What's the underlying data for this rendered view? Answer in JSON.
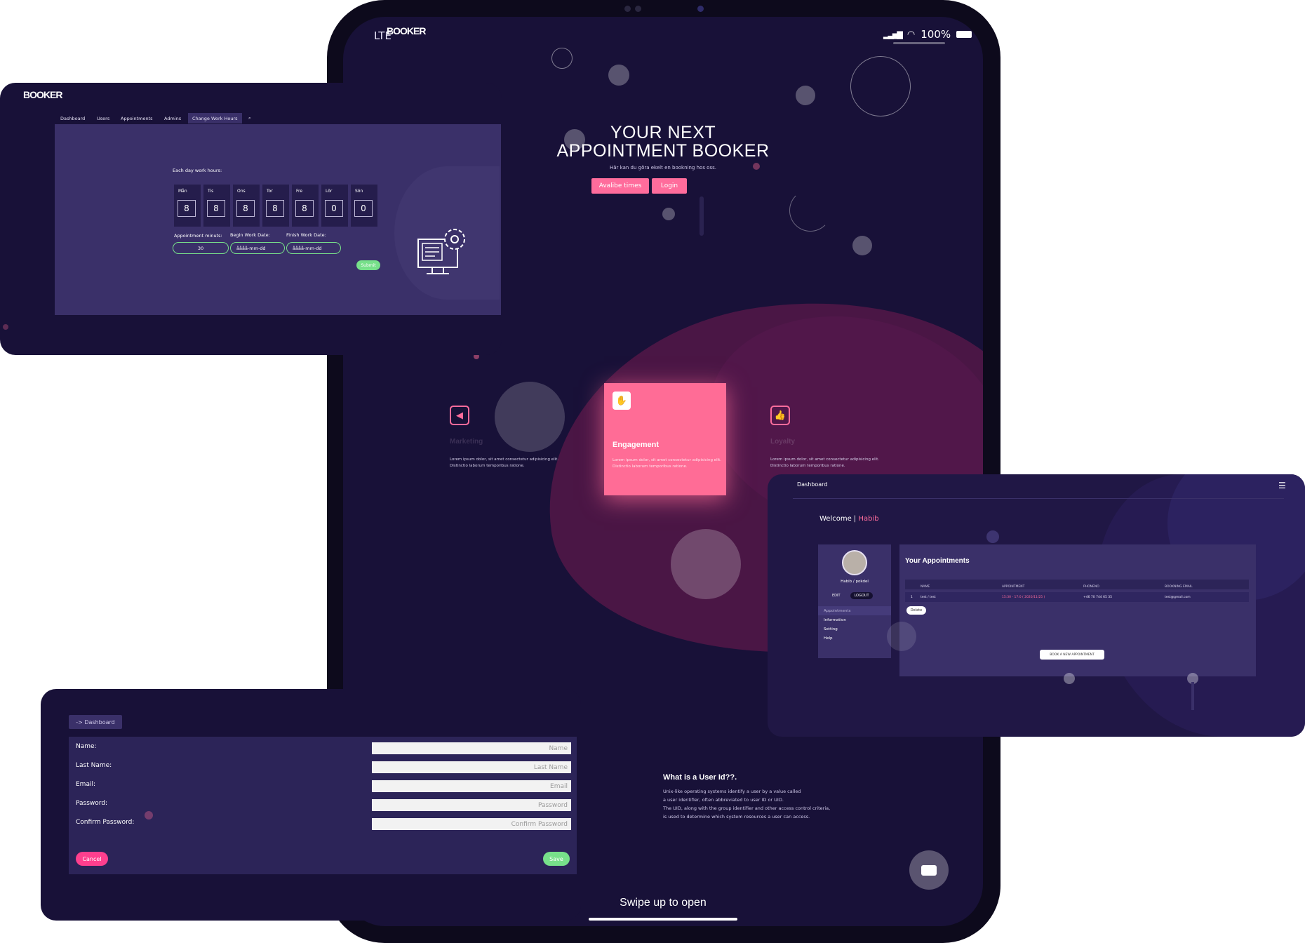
{
  "tablet": {
    "status": {
      "carrier": "LTE",
      "battery": "100%"
    },
    "logo": "BOOKER",
    "hero": {
      "title_line1": "YOUR NEXT",
      "title_line2": "APPOINTMENT BOOKER",
      "subtitle": "Här kan du göra ekelt en bookning hos oss.",
      "btn_available": "Avalibe times",
      "btn_login": "Login"
    },
    "features": [
      {
        "icon": "megaphone-icon",
        "title": "Marketing",
        "desc1": "Lorem ipsum dolor, sit amet consectetur adipisicing elit.",
        "desc2": "Distinctio laborum temporibus ratione."
      },
      {
        "icon": "hand-icon",
        "title": "Engagement",
        "desc1": "Lorem ipsum dolor, sit amet consectetur adipisicing elit.",
        "desc2": "Distinctio laborum temporibus ratione."
      },
      {
        "icon": "thumbs-up-icon",
        "title": "Loyalty",
        "desc1": "Lorem ipsum dolor, sit amet consectetur adipisicing elit.",
        "desc2": "Distinctio laborum temporibus ratione."
      }
    ],
    "uid": {
      "title": "What is a User Id??.",
      "lines": [
        "Unix-like operating systems identify a user by a value called",
        "a user identifier, often abbreviated to user ID or UID.",
        "The UID, along with the group identifier and other access control criteria,",
        "is used to determine which system resources a user can access."
      ]
    },
    "swipe": "Swipe up to open"
  },
  "work_hours": {
    "logo": "BOOKER",
    "nav": [
      "Dashboard",
      "Users",
      "Appointments",
      "Admins",
      "Change Work Hours"
    ],
    "heading": "Each day work hours:",
    "days": [
      {
        "label": "Mån",
        "value": "8"
      },
      {
        "label": "Tis",
        "value": "8"
      },
      {
        "label": "Ons",
        "value": "8"
      },
      {
        "label": "Tor",
        "value": "8"
      },
      {
        "label": "Fre",
        "value": "8"
      },
      {
        "label": "Lör",
        "value": "0"
      },
      {
        "label": "Sön",
        "value": "0"
      }
    ],
    "appt_label": "Appointment minuts:",
    "appt_value": "30",
    "begin_label": "Begin Work Date:",
    "begin_value": "åååå-mm-dd",
    "finish_label": "Finish Work Date:",
    "finish_value": "åååå-mm-dd",
    "submit": "Submit"
  },
  "dashboard": {
    "title": "Dashboard",
    "welcome": "Welcome |",
    "user": "Habib",
    "profile_name": "Habib / pokdel",
    "edit": "EDIT",
    "logout": "LOGOUT",
    "side_links": [
      "Appointments",
      "Information",
      "Setting",
      "Help"
    ],
    "appointments_title": "Your Appointments",
    "columns": [
      "NAME",
      "APPOINTMENT",
      "PHONENO",
      "BOOKNING EMAIL"
    ],
    "rows": [
      {
        "index": "1",
        "name": "test / test",
        "appointment": "15:30 - 17:0 ( 2020/11/25 )",
        "phone": "+46 70 744 65 35",
        "email": "test@gmail.com"
      }
    ],
    "delete": "Delete",
    "book_new": "BOOK A NEW APPOINTMENT"
  },
  "user_form": {
    "back": "-> Dashboard",
    "fields": [
      {
        "label": "Name:",
        "placeholder": "Name"
      },
      {
        "label": "Last Name:",
        "placeholder": "Last Name"
      },
      {
        "label": "Email:",
        "placeholder": "Email"
      },
      {
        "label": "Password:",
        "placeholder": "Password"
      },
      {
        "label": "Confirm Password:",
        "placeholder": "Confirm Password"
      }
    ],
    "cancel": "Cancel",
    "save": "Save"
  },
  "colors": {
    "accent": "#ff6c9c",
    "bg": "#181138",
    "panel": "#3a3069",
    "green": "#77e08a"
  }
}
